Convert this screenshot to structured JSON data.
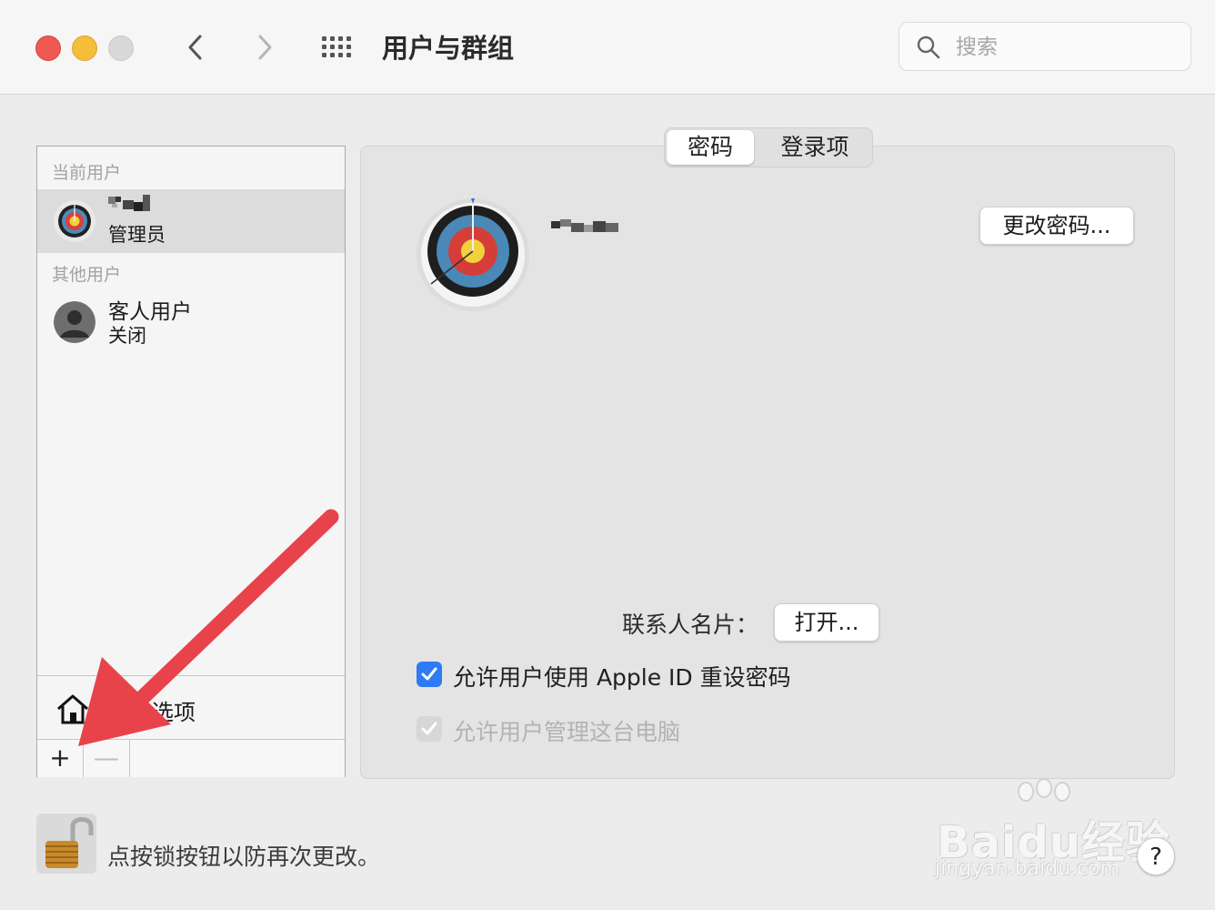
{
  "window": {
    "title": "用户与群组",
    "search_placeholder": "搜索"
  },
  "sidebar": {
    "current_users_label": "当前用户",
    "current_user": {
      "name": "",
      "role": "管理员"
    },
    "other_users_label": "其他用户",
    "other_users": [
      {
        "name": "客人用户",
        "status": "关闭"
      }
    ],
    "login_options_label": "选项",
    "add_label": "+",
    "remove_label": "—"
  },
  "tabs": [
    {
      "label": "密码",
      "active": true
    },
    {
      "label": "登录项",
      "active": false
    }
  ],
  "main": {
    "change_password_button": "更改密码...",
    "contact_card_label": "联系人名片：",
    "open_button": "打开...",
    "checkboxes": [
      {
        "label": "允许用户使用 Apple ID 重设密码",
        "checked": true,
        "enabled": true
      },
      {
        "label": "允许用户管理这台电脑",
        "checked": true,
        "enabled": false
      }
    ]
  },
  "footer": {
    "lock_text": "点按锁按钮以防再次更改。",
    "help_label": "?"
  },
  "watermark": {
    "brand": "Baidu经验",
    "url": "jingyan.baidu.com"
  },
  "colors": {
    "accent": "#2f7bf5",
    "annotation_arrow": "#e8434a"
  }
}
